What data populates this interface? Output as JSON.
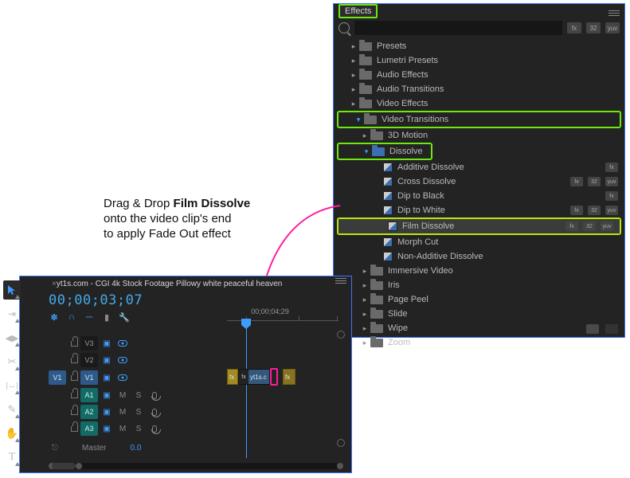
{
  "annotation": {
    "line1_pre": "Drag & Drop ",
    "line1_bold": "Film Dissolve",
    "line2": "onto the video clip's end",
    "line3": "to apply Fade Out effect"
  },
  "effects": {
    "tab": "Effects",
    "search_placeholder": "",
    "filter_badges": [
      "fx",
      "32",
      "yuv"
    ],
    "folders": [
      {
        "label": "Presets",
        "expanded": false,
        "indent": 1
      },
      {
        "label": "Lumetri Presets",
        "expanded": false,
        "indent": 1
      },
      {
        "label": "Audio Effects",
        "expanded": false,
        "indent": 1
      },
      {
        "label": "Audio Transitions",
        "expanded": false,
        "indent": 1
      },
      {
        "label": "Video Effects",
        "expanded": false,
        "indent": 1
      }
    ],
    "video_transitions": {
      "label": "Video Transitions",
      "expanded": true
    },
    "vt_children_top": [
      {
        "label": "3D Motion",
        "expanded": false
      }
    ],
    "dissolve": {
      "label": "Dissolve",
      "expanded": true
    },
    "dissolve_items": [
      {
        "label": "Additive Dissolve",
        "badges": [
          "fx"
        ]
      },
      {
        "label": "Cross Dissolve",
        "badges": [
          "fx",
          "32",
          "yuv"
        ]
      },
      {
        "label": "Dip to Black",
        "badges": [
          "fx"
        ]
      },
      {
        "label": "Dip to White",
        "badges": [
          "fx",
          "32",
          "yuv"
        ]
      },
      {
        "label": "Film Dissolve",
        "selected": true,
        "badges": [
          "fx",
          "32",
          "yuv"
        ]
      },
      {
        "label": "Morph Cut",
        "badges": []
      },
      {
        "label": "Non-Additive Dissolve",
        "badges": []
      }
    ],
    "vt_children_bottom": [
      {
        "label": "Immersive Video"
      },
      {
        "label": "Iris"
      },
      {
        "label": "Page Peel"
      },
      {
        "label": "Slide"
      },
      {
        "label": "Wipe"
      },
      {
        "label": "Zoom"
      }
    ]
  },
  "timeline": {
    "tab": "yt1s.com - CGI 4k Stock Footage Pillowy white peaceful heaven",
    "playhead": "00;00;03;07",
    "ruler_label": "00;00;04;29",
    "tracks": {
      "v3": "V3",
      "v2": "V2",
      "v1": "V1",
      "v1_src": "V1",
      "a1": "A1",
      "a2": "A2",
      "a3": "A3"
    },
    "toggles": {
      "m": "M",
      "s": "S"
    },
    "clip": {
      "fx": "fx",
      "name": "yt1s.c"
    },
    "master": {
      "label": "Master",
      "value": "0.0"
    }
  }
}
